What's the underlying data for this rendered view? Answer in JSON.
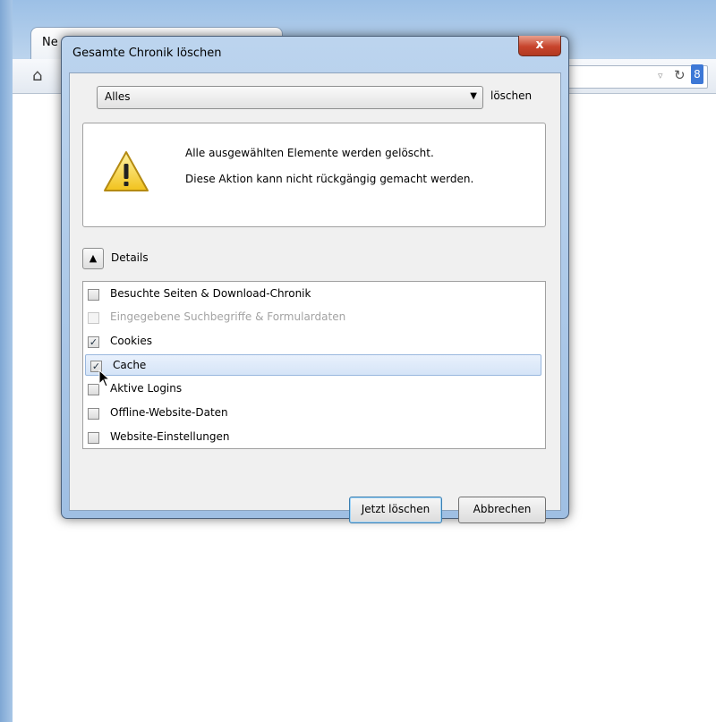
{
  "browser": {
    "tab_label": "Ne",
    "search_engine_label": "8"
  },
  "dialog": {
    "title": "Gesamte Chronik löschen",
    "close_label": "x",
    "range": {
      "value": "Alles",
      "label": "löschen"
    },
    "warning": {
      "line1": "Alle ausgewählten Elemente werden gelöscht.",
      "line2": "Diese Aktion kann nicht rückgängig gemacht werden."
    },
    "details_label": "Details",
    "items": [
      {
        "label": "Besuchte Seiten & Download-Chronik",
        "checked": false,
        "disabled": false
      },
      {
        "label": "Eingegebene Suchbegriffe & Formulardaten",
        "checked": false,
        "disabled": true
      },
      {
        "label": "Cookies",
        "checked": true,
        "disabled": false
      },
      {
        "label": "Cache",
        "checked": true,
        "disabled": false
      },
      {
        "label": "Aktive Logins",
        "checked": false,
        "disabled": false
      },
      {
        "label": "Offline-Website-Daten",
        "checked": false,
        "disabled": false
      },
      {
        "label": "Website-Einstellungen",
        "checked": false,
        "disabled": false
      }
    ],
    "buttons": {
      "confirm": "Jetzt löschen",
      "cancel": "Abbrechen"
    }
  },
  "icons": {
    "home": "home-icon",
    "reload": "reload-icon",
    "dropdown": "chevron-down-icon",
    "warning": "warning-icon",
    "details_toggle": "chevron-up-icon",
    "cursor": "mouse-cursor-icon"
  }
}
